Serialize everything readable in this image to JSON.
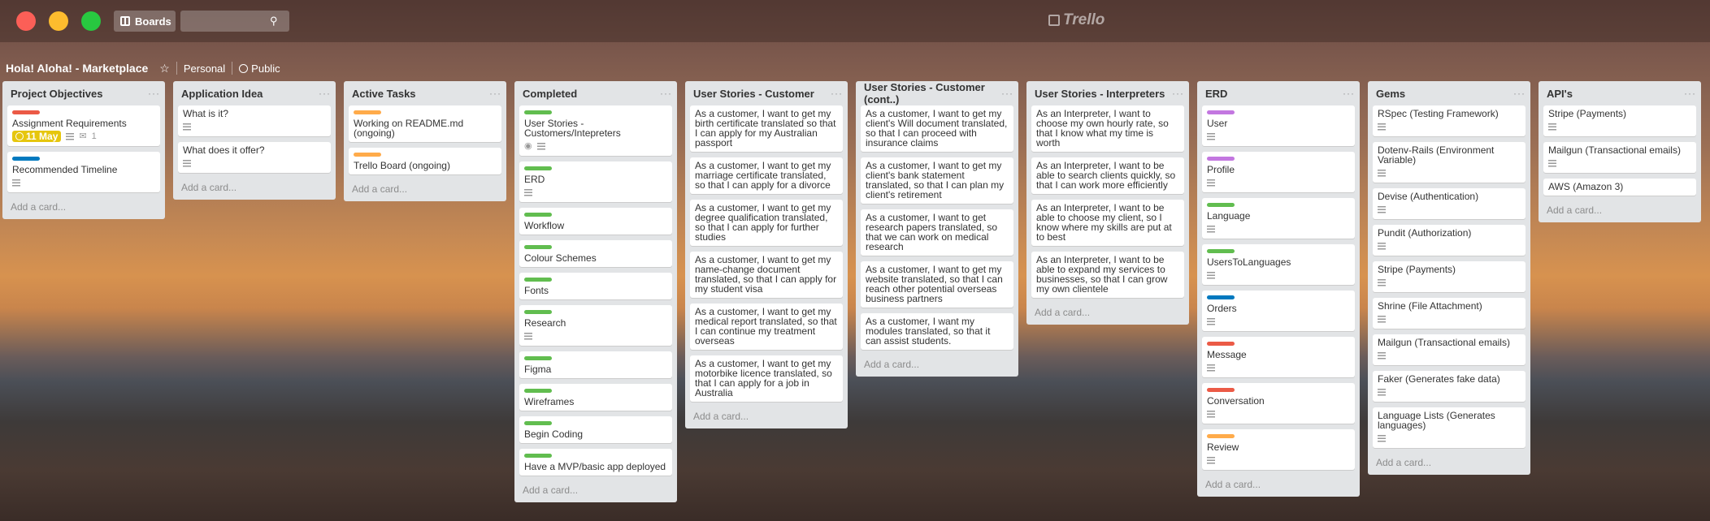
{
  "header": {
    "boards_label": "Boards",
    "search_placeholder": "",
    "logo_text": "Trello",
    "board_title": "Hola! Aloha! - Marketplace",
    "personal_label": "Personal",
    "public_label": "Public"
  },
  "colors": {
    "green": "#61bd4f",
    "red": "#eb5a46",
    "blue": "#0079bf",
    "orange": "#ffab4a",
    "purple": "#c377e0",
    "yellow": "#e6c60d"
  },
  "add_card_label": "Add a card...",
  "lists": [
    {
      "title": "Project Objectives",
      "cards": [
        {
          "label_color": "#eb5a46",
          "text": "Assignment Requirements",
          "due": "11 May",
          "desc": true,
          "attachments": "1"
        },
        {
          "label_color": "#0079bf",
          "text": "Recommended Timeline",
          "desc": true
        }
      ]
    },
    {
      "title": "Application Idea",
      "cards": [
        {
          "text": "What is it?",
          "desc": true
        },
        {
          "text": "What does it offer?",
          "desc": true
        }
      ]
    },
    {
      "title": "Active Tasks",
      "cards": [
        {
          "label_color": "#ffab4a",
          "text": "Working on README.md (ongoing)"
        },
        {
          "label_color": "#ffab4a",
          "text": "Trello Board (ongoing)"
        }
      ]
    },
    {
      "title": "Completed",
      "cards": [
        {
          "label_color": "#61bd4f",
          "text": "User Stories - Customers/Intepreters",
          "watch": true,
          "desc": true
        },
        {
          "label_color": "#61bd4f",
          "text": "ERD",
          "desc": true
        },
        {
          "label_color": "#61bd4f",
          "text": "Workflow"
        },
        {
          "label_color": "#61bd4f",
          "text": "Colour Schemes"
        },
        {
          "label_color": "#61bd4f",
          "text": "Fonts"
        },
        {
          "label_color": "#61bd4f",
          "text": "Research",
          "desc": true
        },
        {
          "label_color": "#61bd4f",
          "text": "Figma"
        },
        {
          "label_color": "#61bd4f",
          "text": "Wireframes"
        },
        {
          "label_color": "#61bd4f",
          "text": "Begin Coding"
        },
        {
          "label_color": "#61bd4f",
          "text": "Have a MVP/basic app deployed"
        }
      ]
    },
    {
      "title": "User Stories - Customer",
      "cards": [
        {
          "text": "As a customer, I want to get my birth certificate translated so that I can apply for my Australian passport"
        },
        {
          "text": "As a customer, I want to get my marriage certificate translated, so that I can apply for a divorce"
        },
        {
          "text": "As a customer, I want to get my degree qualification translated, so that I can apply for further studies"
        },
        {
          "text": "As a customer, I want to get my name-change document translated, so that I can apply for my student visa"
        },
        {
          "text": "As a customer, I want to get my medical report translated, so that I can continue my treatment overseas"
        },
        {
          "text": "As a customer, I want to get my motorbike licence translated, so that I can apply for a job in Australia"
        }
      ]
    },
    {
      "title": "User Stories - Customer (cont..)",
      "cards": [
        {
          "text": "As a customer, I want to get my client's Will document translated, so that I can proceed with insurance claims"
        },
        {
          "text": "As a customer, I want to get my client's bank statement translated, so that I can plan my client's retirement"
        },
        {
          "text": "As a customer, I want to get research papers translated, so that we can work on medical research"
        },
        {
          "text": "As a customer, I want to get my website translated, so that I can reach other potential overseas business partners"
        },
        {
          "text": "As a customer, I want my modules translated, so that it can assist students."
        }
      ]
    },
    {
      "title": "User Stories - Interpreters",
      "cards": [
        {
          "text": "As an Interpreter, I want to choose my own hourly rate, so that I know what my time is worth"
        },
        {
          "text": "As an Interpreter, I want to be able to search clients quickly, so that I can work more efficiently"
        },
        {
          "text": "As an Interpreter, I want to be able to choose my client, so I know where my skills are put at to best"
        },
        {
          "text": "As an Interpreter, I want to be able to expand my services to businesses, so that I can grow my own clientele"
        }
      ]
    },
    {
      "title": "ERD",
      "cards": [
        {
          "label_color": "#c377e0",
          "text": "User",
          "desc": true
        },
        {
          "label_color": "#c377e0",
          "text": "Profile",
          "desc": true
        },
        {
          "label_color": "#61bd4f",
          "text": "Language",
          "desc": true
        },
        {
          "label_color": "#61bd4f",
          "text": "UsersToLanguages",
          "desc": true
        },
        {
          "label_color": "#0079bf",
          "text": "Orders",
          "desc": true
        },
        {
          "label_color": "#eb5a46",
          "text": "Message",
          "desc": true
        },
        {
          "label_color": "#eb5a46",
          "text": "Conversation",
          "desc": true
        },
        {
          "label_color": "#ffab4a",
          "text": "Review",
          "desc": true
        }
      ]
    },
    {
      "title": "Gems",
      "cards": [
        {
          "text": "RSpec (Testing Framework)",
          "desc": true
        },
        {
          "text": "Dotenv-Rails (Environment Variable)",
          "desc": true
        },
        {
          "text": "Devise (Authentication)",
          "desc": true
        },
        {
          "text": "Pundit (Authorization)",
          "desc": true
        },
        {
          "text": "Stripe (Payments)",
          "desc": true
        },
        {
          "text": "Shrine (File Attachment)",
          "desc": true
        },
        {
          "text": "Mailgun (Transactional emails)",
          "desc": true
        },
        {
          "text": "Faker (Generates fake data)",
          "desc": true
        },
        {
          "text": "Language Lists (Generates languages)",
          "desc": true
        }
      ]
    },
    {
      "title": "API's",
      "cards": [
        {
          "text": "Stripe (Payments)",
          "desc": true
        },
        {
          "text": "Mailgun (Transactional emails)",
          "desc": true
        },
        {
          "text": "AWS (Amazon 3)"
        }
      ]
    }
  ]
}
